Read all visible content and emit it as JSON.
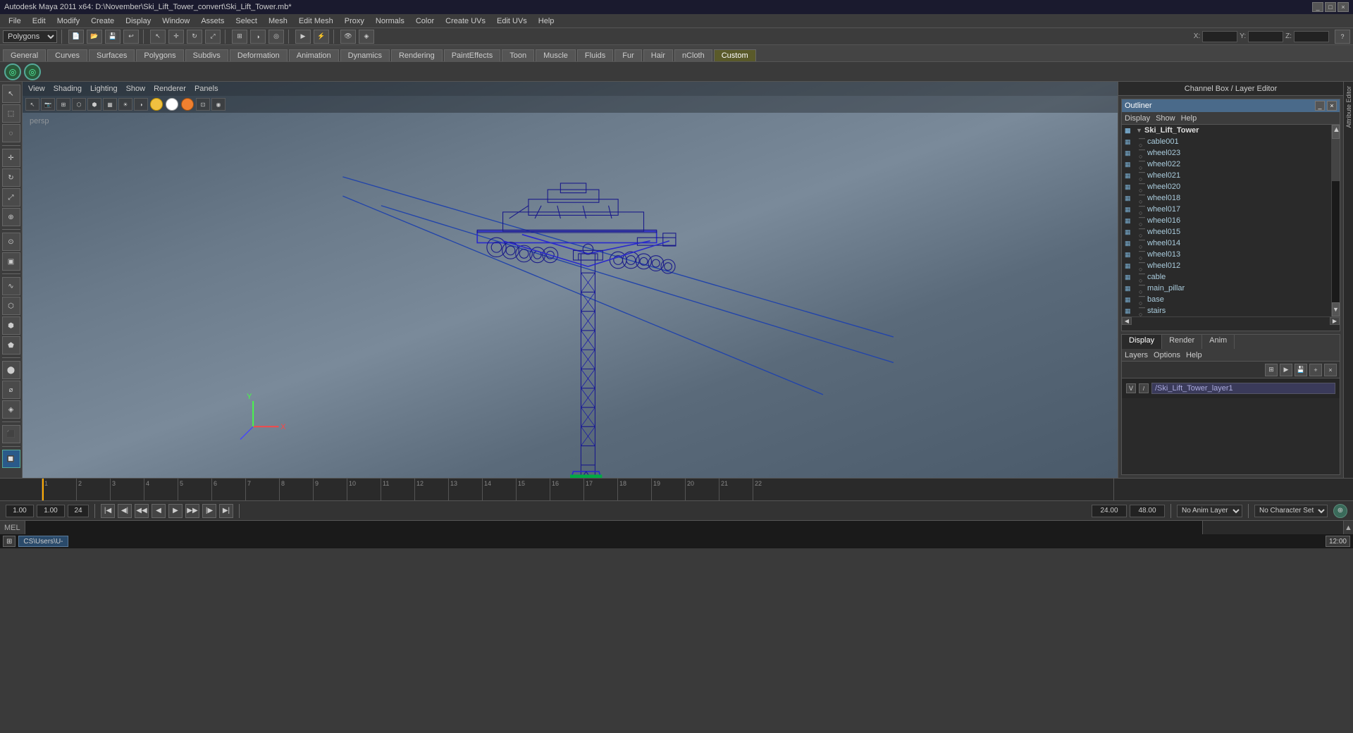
{
  "title_bar": {
    "title": "Autodesk Maya 2011 x64: D:\\November\\Ski_Lift_Tower_convert\\Ski_Lift_Tower.mb*",
    "controls": [
      "_",
      "□",
      "×"
    ]
  },
  "menu_bar": {
    "items": [
      "File",
      "Edit",
      "Modify",
      "Create",
      "Display",
      "Window",
      "Assets",
      "Select",
      "Mesh",
      "Edit Mesh",
      "Proxy",
      "Normals",
      "Color",
      "Create UVs",
      "Edit UVs",
      "Help"
    ]
  },
  "mode_selector": {
    "value": "Polygons"
  },
  "main_toolbar": {
    "tools": [
      "file-open",
      "file-save",
      "undo",
      "redo",
      "select",
      "move",
      "rotate",
      "scale",
      "snap-grid",
      "snap-curve",
      "snap-point",
      "snap-view",
      "render-current",
      "render-sequence",
      "hardware-render",
      "ipr-render"
    ]
  },
  "tabs": {
    "items": [
      "General",
      "Curves",
      "Surfaces",
      "Polygons",
      "Subdivs",
      "Deformation",
      "Animation",
      "Dynamics",
      "Rendering",
      "PaintEffects",
      "Toon",
      "Muscle",
      "Fluids",
      "Fur",
      "Hair",
      "nCloth",
      "Custom"
    ]
  },
  "sync_buttons": {
    "labels": [
      "◎",
      "◎"
    ]
  },
  "viewport": {
    "menus": [
      "View",
      "Shading",
      "Lighting",
      "Show",
      "Renderer",
      "Panels"
    ],
    "corner_label": "persp",
    "axis_labels": {
      "x": "X",
      "y": "Y"
    }
  },
  "channelbox": {
    "title": "Channel Box / Layer Editor"
  },
  "outliner": {
    "title": "Outliner",
    "menus": [
      "Display",
      "Show",
      "Help"
    ],
    "items": [
      {
        "name": "Ski_Lift_Tower",
        "level": 0,
        "is_root": true
      },
      {
        "name": "cable001",
        "level": 1
      },
      {
        "name": "wheel023",
        "level": 1
      },
      {
        "name": "wheel022",
        "level": 1
      },
      {
        "name": "wheel021",
        "level": 1
      },
      {
        "name": "wheel020",
        "level": 1
      },
      {
        "name": "wheel018",
        "level": 1
      },
      {
        "name": "wheel017",
        "level": 1
      },
      {
        "name": "wheel016",
        "level": 1
      },
      {
        "name": "wheel015",
        "level": 1
      },
      {
        "name": "wheel014",
        "level": 1
      },
      {
        "name": "wheel013",
        "level": 1
      },
      {
        "name": "wheel012",
        "level": 1
      },
      {
        "name": "cable",
        "level": 1
      },
      {
        "name": "main_pillar",
        "level": 1
      },
      {
        "name": "base",
        "level": 1
      },
      {
        "name": "stairs",
        "level": 1
      }
    ]
  },
  "layer_editor": {
    "tabs": [
      "Display",
      "Render",
      "Anim"
    ],
    "menus": [
      "Layers",
      "Options",
      "Help"
    ],
    "active_tab": "Display",
    "layers": [
      {
        "v": "V",
        "name": "/Ski_Lift_Tower_layer1"
      }
    ]
  },
  "timeline": {
    "start": 1,
    "end": 24,
    "current": 1,
    "ticks": [
      1,
      2,
      3,
      4,
      5,
      6,
      7,
      8,
      9,
      10,
      11,
      12,
      13,
      14,
      15,
      16,
      17,
      18,
      19,
      20,
      21,
      22
    ]
  },
  "playback": {
    "start_frame": "1.00",
    "current_frame": "1.00",
    "end_frame_range": "24",
    "playback_end": "24.00",
    "anim_end": "48.00",
    "no_anim_layer": "No Anim Layer",
    "no_char_set": "No Character Set",
    "buttons": [
      "skip-back",
      "prev-frame",
      "prev-key",
      "play-back",
      "play-fwd",
      "next-key",
      "next-frame",
      "skip-fwd"
    ]
  },
  "command_line": {
    "label": "MEL",
    "placeholder": "",
    "status": ""
  },
  "taskbar": {
    "item": "CS\\Users\\U-"
  },
  "attr_strip": {
    "channel_label": "Channel Box / Layer Editor",
    "attr_label": "Attribute Editor"
  },
  "icons": {
    "mesh_icon": "▦",
    "arrow_right": "▶",
    "arrow_left": "◀",
    "expand": "▼",
    "collapse": "▶",
    "close": "×",
    "minimize": "_",
    "maximize": "□"
  }
}
